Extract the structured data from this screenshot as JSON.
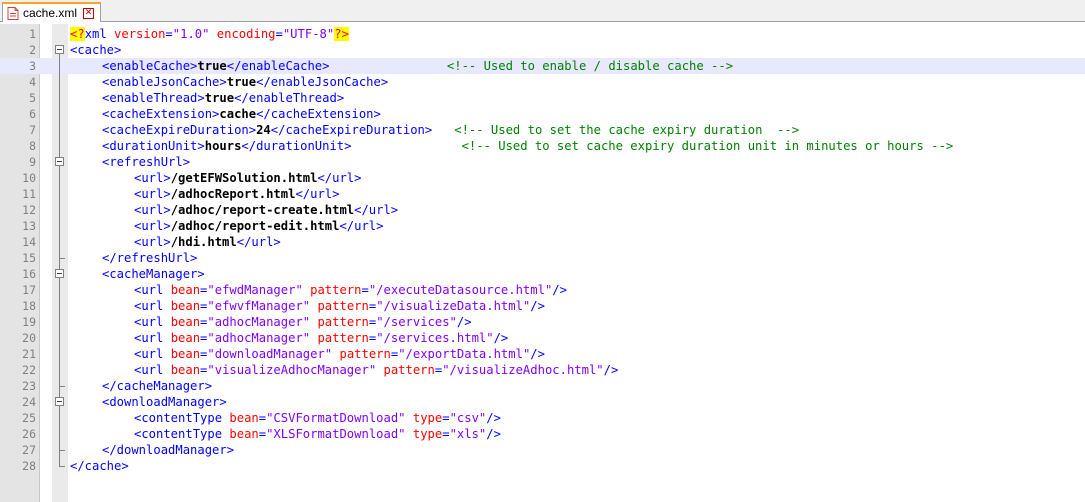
{
  "tab": {
    "filename": "cache.xml",
    "close_symbol": "✕",
    "icon": "file-icon"
  },
  "lines": [
    {
      "n": "1",
      "fold": "none",
      "indent": 0,
      "segs": [
        [
          "pi",
          "<?"
        ],
        [
          "tg",
          "xml "
        ],
        [
          "at",
          "version"
        ],
        [
          "tg",
          "="
        ],
        [
          "av",
          "\"1.0\""
        ],
        [
          "tg",
          " "
        ],
        [
          "at",
          "encoding"
        ],
        [
          "tg",
          "="
        ],
        [
          "av",
          "\"UTF-8\""
        ],
        [
          "pi",
          "?>"
        ]
      ]
    },
    {
      "n": "2",
      "fold": "open",
      "indent": 0,
      "segs": [
        [
          "tg",
          "<cache>"
        ]
      ]
    },
    {
      "n": "3",
      "fold": "line",
      "indent": 1,
      "current": true,
      "segs": [
        [
          "tg",
          "<enableCache>"
        ],
        [
          "tx",
          "true"
        ],
        [
          "tg",
          "</enableCache>"
        ],
        [
          "tx",
          "                "
        ],
        [
          "cm",
          "<!-- Used to enable / disable cache -->"
        ]
      ]
    },
    {
      "n": "4",
      "fold": "line",
      "indent": 1,
      "segs": [
        [
          "tg",
          "<enableJsonCache>"
        ],
        [
          "tx",
          "true"
        ],
        [
          "tg",
          "</enableJsonCache>"
        ]
      ]
    },
    {
      "n": "5",
      "fold": "line",
      "indent": 1,
      "segs": [
        [
          "tg",
          "<enableThread>"
        ],
        [
          "tx",
          "true"
        ],
        [
          "tg",
          "</enableThread>"
        ]
      ]
    },
    {
      "n": "6",
      "fold": "line",
      "indent": 1,
      "segs": [
        [
          "tg",
          "<cacheExtension>"
        ],
        [
          "tx",
          "cache"
        ],
        [
          "tg",
          "</cacheExtension>"
        ]
      ]
    },
    {
      "n": "7",
      "fold": "line",
      "indent": 1,
      "segs": [
        [
          "tg",
          "<cacheExpireDuration>"
        ],
        [
          "tx",
          "24"
        ],
        [
          "tg",
          "</cacheExpireDuration>"
        ],
        [
          "tx",
          "   "
        ],
        [
          "cm",
          "<!-- Used to set the cache expiry duration  -->"
        ]
      ]
    },
    {
      "n": "8",
      "fold": "line",
      "indent": 1,
      "segs": [
        [
          "tg",
          "<durationUnit>"
        ],
        [
          "tx",
          "hours"
        ],
        [
          "tg",
          "</durationUnit>"
        ],
        [
          "tx",
          "               "
        ],
        [
          "cm",
          "<!-- Used to set cache expiry duration unit in minutes or hours -->"
        ]
      ]
    },
    {
      "n": "9",
      "fold": "open",
      "indent": 1,
      "segs": [
        [
          "tg",
          "<refreshUrl>"
        ]
      ]
    },
    {
      "n": "10",
      "fold": "line",
      "indent": 2,
      "segs": [
        [
          "tg",
          "<url>"
        ],
        [
          "tx",
          "/getEFWSolution.html"
        ],
        [
          "tg",
          "</url>"
        ]
      ]
    },
    {
      "n": "11",
      "fold": "line",
      "indent": 2,
      "segs": [
        [
          "tg",
          "<url>"
        ],
        [
          "tx",
          "/adhocReport.html"
        ],
        [
          "tg",
          "</url>"
        ]
      ]
    },
    {
      "n": "12",
      "fold": "line",
      "indent": 2,
      "segs": [
        [
          "tg",
          "<url>"
        ],
        [
          "tx",
          "/adhoc/report-create.html"
        ],
        [
          "tg",
          "</url>"
        ]
      ]
    },
    {
      "n": "13",
      "fold": "line",
      "indent": 2,
      "segs": [
        [
          "tg",
          "<url>"
        ],
        [
          "tx",
          "/adhoc/report-edit.html"
        ],
        [
          "tg",
          "</url>"
        ]
      ]
    },
    {
      "n": "14",
      "fold": "line",
      "indent": 2,
      "segs": [
        [
          "tg",
          "<url>"
        ],
        [
          "tx",
          "/hdi.html"
        ],
        [
          "tg",
          "</url>"
        ]
      ]
    },
    {
      "n": "15",
      "fold": "end",
      "indent": 1,
      "segs": [
        [
          "tg",
          "</refreshUrl>"
        ]
      ]
    },
    {
      "n": "16",
      "fold": "open",
      "indent": 1,
      "segs": [
        [
          "tg",
          "<cacheManager>"
        ]
      ]
    },
    {
      "n": "17",
      "fold": "line",
      "indent": 2,
      "segs": [
        [
          "tg",
          "<url "
        ],
        [
          "at",
          "bean"
        ],
        [
          "tg",
          "="
        ],
        [
          "av",
          "\"efwdManager\""
        ],
        [
          "tg",
          " "
        ],
        [
          "at",
          "pattern"
        ],
        [
          "tg",
          "="
        ],
        [
          "av",
          "\"/executeDatasource.html\""
        ],
        [
          "tg",
          "/>"
        ]
      ]
    },
    {
      "n": "18",
      "fold": "line",
      "indent": 2,
      "segs": [
        [
          "tg",
          "<url "
        ],
        [
          "at",
          "bean"
        ],
        [
          "tg",
          "="
        ],
        [
          "av",
          "\"efwvfManager\""
        ],
        [
          "tg",
          " "
        ],
        [
          "at",
          "pattern"
        ],
        [
          "tg",
          "="
        ],
        [
          "av",
          "\"/visualizeData.html\""
        ],
        [
          "tg",
          "/>"
        ]
      ]
    },
    {
      "n": "19",
      "fold": "line",
      "indent": 2,
      "segs": [
        [
          "tg",
          "<url "
        ],
        [
          "at",
          "bean"
        ],
        [
          "tg",
          "="
        ],
        [
          "av",
          "\"adhocManager\""
        ],
        [
          "tg",
          " "
        ],
        [
          "at",
          "pattern"
        ],
        [
          "tg",
          "="
        ],
        [
          "av",
          "\"/services\""
        ],
        [
          "tg",
          "/>"
        ]
      ]
    },
    {
      "n": "20",
      "fold": "line",
      "indent": 2,
      "segs": [
        [
          "tg",
          "<url "
        ],
        [
          "at",
          "bean"
        ],
        [
          "tg",
          "="
        ],
        [
          "av",
          "\"adhocManager\""
        ],
        [
          "tg",
          " "
        ],
        [
          "at",
          "pattern"
        ],
        [
          "tg",
          "="
        ],
        [
          "av",
          "\"/services.html\""
        ],
        [
          "tg",
          "/>"
        ]
      ]
    },
    {
      "n": "21",
      "fold": "line",
      "indent": 2,
      "segs": [
        [
          "tg",
          "<url "
        ],
        [
          "at",
          "bean"
        ],
        [
          "tg",
          "="
        ],
        [
          "av",
          "\"downloadManager\""
        ],
        [
          "tg",
          " "
        ],
        [
          "at",
          "pattern"
        ],
        [
          "tg",
          "="
        ],
        [
          "av",
          "\"/exportData.html\""
        ],
        [
          "tg",
          "/>"
        ]
      ]
    },
    {
      "n": "22",
      "fold": "line",
      "indent": 2,
      "segs": [
        [
          "tg",
          "<url "
        ],
        [
          "at",
          "bean"
        ],
        [
          "tg",
          "="
        ],
        [
          "av",
          "\"visualizeAdhocManager\""
        ],
        [
          "tg",
          " "
        ],
        [
          "at",
          "pattern"
        ],
        [
          "tg",
          "="
        ],
        [
          "av",
          "\"/visualizeAdhoc.html\""
        ],
        [
          "tg",
          "/>"
        ]
      ]
    },
    {
      "n": "23",
      "fold": "end",
      "indent": 1,
      "segs": [
        [
          "tg",
          "</cacheManager>"
        ]
      ]
    },
    {
      "n": "24",
      "fold": "open",
      "indent": 1,
      "segs": [
        [
          "tg",
          "<downloadManager>"
        ]
      ]
    },
    {
      "n": "25",
      "fold": "line",
      "indent": 2,
      "segs": [
        [
          "tg",
          "<contentType "
        ],
        [
          "at",
          "bean"
        ],
        [
          "tg",
          "="
        ],
        [
          "av",
          "\"CSVFormatDownload\""
        ],
        [
          "tg",
          " "
        ],
        [
          "at",
          "type"
        ],
        [
          "tg",
          "="
        ],
        [
          "av",
          "\"csv\""
        ],
        [
          "tg",
          "/>"
        ]
      ]
    },
    {
      "n": "26",
      "fold": "line",
      "indent": 2,
      "segs": [
        [
          "tg",
          "<contentType "
        ],
        [
          "at",
          "bean"
        ],
        [
          "tg",
          "="
        ],
        [
          "av",
          "\"XLSFormatDownload\""
        ],
        [
          "tg",
          " "
        ],
        [
          "at",
          "type"
        ],
        [
          "tg",
          "="
        ],
        [
          "av",
          "\"xls\""
        ],
        [
          "tg",
          "/>"
        ]
      ]
    },
    {
      "n": "27",
      "fold": "end",
      "indent": 1,
      "segs": [
        [
          "tg",
          "</downloadManager>"
        ]
      ]
    },
    {
      "n": "28",
      "fold": "last",
      "indent": 0,
      "segs": [
        [
          "tg",
          "</cache>"
        ]
      ]
    }
  ]
}
